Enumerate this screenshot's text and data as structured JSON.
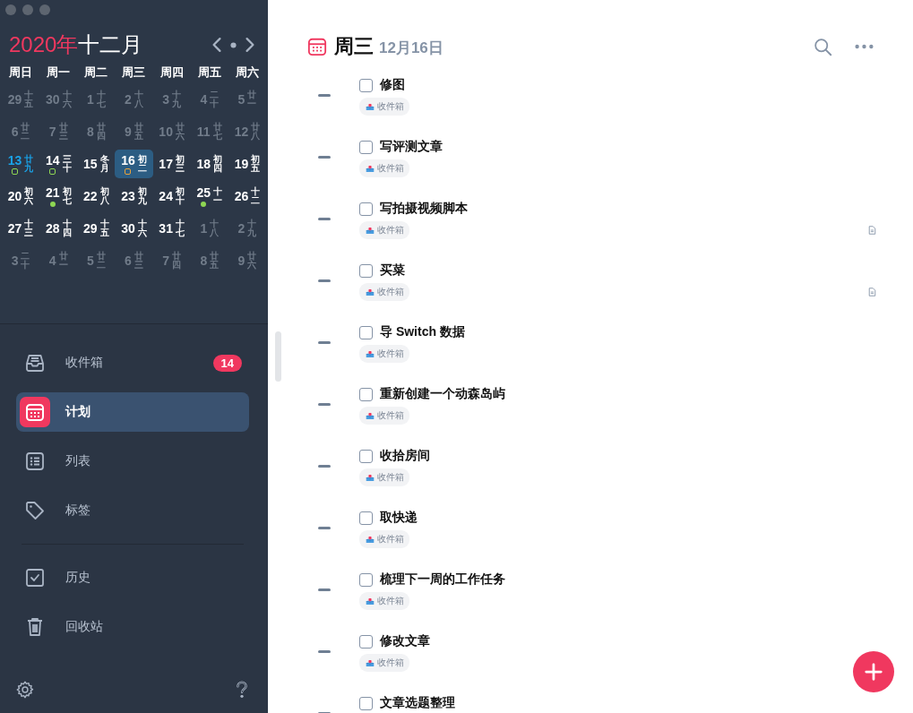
{
  "calendar": {
    "year": "2020年",
    "month": "十二月",
    "weekdays": [
      "周日",
      "周一",
      "周二",
      "周三",
      "周四",
      "周五",
      "周六"
    ],
    "weeks": [
      [
        {
          "day": "29",
          "lunar": "十五",
          "kind": "muted",
          "selected": false
        },
        {
          "day": "30",
          "lunar": "十六",
          "kind": "muted",
          "selected": false
        },
        {
          "day": "1",
          "lunar": "十七",
          "kind": "muted",
          "selected": false
        },
        {
          "day": "2",
          "lunar": "十八",
          "kind": "muted",
          "selected": false
        },
        {
          "day": "3",
          "lunar": "十九",
          "kind": "muted",
          "selected": false
        },
        {
          "day": "4",
          "lunar": "二十",
          "kind": "muted",
          "selected": false
        },
        {
          "day": "5",
          "lunar": "廿一",
          "kind": "muted",
          "selected": false
        }
      ],
      [
        {
          "day": "6",
          "lunar": "廿二",
          "kind": "muted",
          "selected": false
        },
        {
          "day": "7",
          "lunar": "廿三",
          "kind": "muted",
          "selected": false
        },
        {
          "day": "8",
          "lunar": "廿四",
          "kind": "muted",
          "selected": false
        },
        {
          "day": "9",
          "lunar": "廿五",
          "kind": "muted",
          "selected": false
        },
        {
          "day": "10",
          "lunar": "廿六",
          "kind": "muted",
          "selected": false
        },
        {
          "day": "11",
          "lunar": "廿七",
          "kind": "muted",
          "selected": false
        },
        {
          "day": "12",
          "lunar": "廿八",
          "kind": "muted",
          "selected": false
        }
      ],
      [
        {
          "day": "13",
          "lunar": "廿九",
          "kind": "today",
          "selected": false,
          "marker": {
            "kind": "ring",
            "color": "#8ed653"
          }
        },
        {
          "day": "14",
          "lunar": "三十",
          "kind": "normal",
          "selected": false,
          "marker": {
            "kind": "ring",
            "color": "#8ed653"
          }
        },
        {
          "day": "15",
          "lunar": "冬月",
          "kind": "normal",
          "selected": false
        },
        {
          "day": "16",
          "lunar": "初二",
          "kind": "normal",
          "selected": true,
          "marker": {
            "kind": "ring",
            "color": "#e8a23a"
          }
        },
        {
          "day": "17",
          "lunar": "初三",
          "kind": "normal",
          "selected": false
        },
        {
          "day": "18",
          "lunar": "初四",
          "kind": "normal",
          "selected": false
        },
        {
          "day": "19",
          "lunar": "初五",
          "kind": "normal",
          "selected": false
        }
      ],
      [
        {
          "day": "20",
          "lunar": "初六",
          "kind": "normal",
          "selected": false
        },
        {
          "day": "21",
          "lunar": "初七",
          "kind": "normal",
          "selected": false,
          "marker": {
            "kind": "dot",
            "color": "#8ed653"
          }
        },
        {
          "day": "22",
          "lunar": "初八",
          "kind": "normal",
          "selected": false
        },
        {
          "day": "23",
          "lunar": "初九",
          "kind": "normal",
          "selected": false
        },
        {
          "day": "24",
          "lunar": "初十",
          "kind": "normal",
          "selected": false
        },
        {
          "day": "25",
          "lunar": "十一",
          "kind": "normal",
          "selected": false,
          "marker": {
            "kind": "dot",
            "color": "#8ed653"
          }
        },
        {
          "day": "26",
          "lunar": "十二",
          "kind": "normal",
          "selected": false
        }
      ],
      [
        {
          "day": "27",
          "lunar": "十三",
          "kind": "normal",
          "selected": false
        },
        {
          "day": "28",
          "lunar": "十四",
          "kind": "normal",
          "selected": false
        },
        {
          "day": "29",
          "lunar": "十五",
          "kind": "normal",
          "selected": false
        },
        {
          "day": "30",
          "lunar": "十六",
          "kind": "normal",
          "selected": false
        },
        {
          "day": "31",
          "lunar": "十七",
          "kind": "normal",
          "selected": false
        },
        {
          "day": "1",
          "lunar": "十八",
          "kind": "muted",
          "selected": false
        },
        {
          "day": "2",
          "lunar": "十九",
          "kind": "muted",
          "selected": false
        }
      ],
      [
        {
          "day": "3",
          "lunar": "二十",
          "kind": "muted",
          "selected": false
        },
        {
          "day": "4",
          "lunar": "廿一",
          "kind": "muted",
          "selected": false
        },
        {
          "day": "5",
          "lunar": "廿二",
          "kind": "muted",
          "selected": false
        },
        {
          "day": "6",
          "lunar": "廿三",
          "kind": "muted",
          "selected": false
        },
        {
          "day": "7",
          "lunar": "廿四",
          "kind": "muted",
          "selected": false
        },
        {
          "day": "8",
          "lunar": "廿五",
          "kind": "muted",
          "selected": false
        },
        {
          "day": "9",
          "lunar": "廿六",
          "kind": "muted",
          "selected": false
        }
      ]
    ]
  },
  "sidebar": {
    "groups": [
      [
        {
          "label": "收件箱",
          "selected": false,
          "badge": "14"
        },
        {
          "label": "计划",
          "selected": true
        },
        {
          "label": "列表",
          "selected": false
        },
        {
          "label": "标签",
          "selected": false
        }
      ],
      [
        {
          "label": "历史",
          "selected": false
        },
        {
          "label": "回收站",
          "selected": false
        }
      ]
    ]
  },
  "header": {
    "weekday": "周三",
    "date": "12月16日"
  },
  "tasks": [
    {
      "title": "修图",
      "checked": false,
      "tag": "收件箱",
      "has_note": false
    },
    {
      "title": "写评测文章",
      "checked": false,
      "tag": "收件箱",
      "has_note": false
    },
    {
      "title": "写拍摄视频脚本",
      "checked": false,
      "tag": "收件箱",
      "has_note": true
    },
    {
      "title": "买菜",
      "checked": false,
      "tag": "收件箱",
      "has_note": true
    },
    {
      "title": "导 Switch 数据",
      "checked": false,
      "tag": "收件箱",
      "has_note": false
    },
    {
      "title": "重新创建一个动森岛屿",
      "checked": false,
      "tag": "收件箱",
      "has_note": false
    },
    {
      "title": "收拾房间",
      "checked": false,
      "tag": "收件箱",
      "has_note": false
    },
    {
      "title": "取快递",
      "checked": false,
      "tag": "收件箱",
      "has_note": false
    },
    {
      "title": "梳理下一周的工作任务",
      "checked": false,
      "tag": "收件箱",
      "has_note": false
    },
    {
      "title": "修改文章",
      "checked": false,
      "tag": "收件箱",
      "has_note": false
    },
    {
      "title": "文章选题整理",
      "checked": false,
      "has_note": false
    }
  ]
}
